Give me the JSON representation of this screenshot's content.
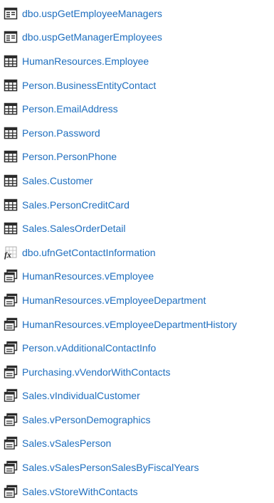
{
  "items": [
    {
      "label": "dbo.uspGetEmployeeManagers",
      "icon": "stored-procedure-icon"
    },
    {
      "label": "dbo.uspGetManagerEmployees",
      "icon": "stored-procedure-icon"
    },
    {
      "label": "HumanResources.Employee",
      "icon": "table-icon"
    },
    {
      "label": "Person.BusinessEntityContact",
      "icon": "table-icon"
    },
    {
      "label": "Person.EmailAddress",
      "icon": "table-icon"
    },
    {
      "label": "Person.Password",
      "icon": "table-icon"
    },
    {
      "label": "Person.PersonPhone",
      "icon": "table-icon"
    },
    {
      "label": "Sales.Customer",
      "icon": "table-icon"
    },
    {
      "label": "Sales.PersonCreditCard",
      "icon": "table-icon"
    },
    {
      "label": "Sales.SalesOrderDetail",
      "icon": "table-icon"
    },
    {
      "label": "dbo.ufnGetContactInformation",
      "icon": "function-icon"
    },
    {
      "label": "HumanResources.vEmployee",
      "icon": "view-icon"
    },
    {
      "label": "HumanResources.vEmployeeDepartment",
      "icon": "view-icon"
    },
    {
      "label": "HumanResources.vEmployeeDepartmentHistory",
      "icon": "view-icon"
    },
    {
      "label": "Person.vAdditionalContactInfo",
      "icon": "view-icon"
    },
    {
      "label": "Purchasing.vVendorWithContacts",
      "icon": "view-icon"
    },
    {
      "label": "Sales.vIndividualCustomer",
      "icon": "view-icon"
    },
    {
      "label": "Sales.vPersonDemographics",
      "icon": "view-icon"
    },
    {
      "label": "Sales.vSalesPerson",
      "icon": "view-icon"
    },
    {
      "label": "Sales.vSalesPersonSalesByFiscalYears",
      "icon": "view-icon"
    },
    {
      "label": "Sales.vStoreWithContacts",
      "icon": "view-icon"
    }
  ],
  "colors": {
    "link": "#1f6fbf",
    "icon_dark": "#2b2b2b"
  }
}
